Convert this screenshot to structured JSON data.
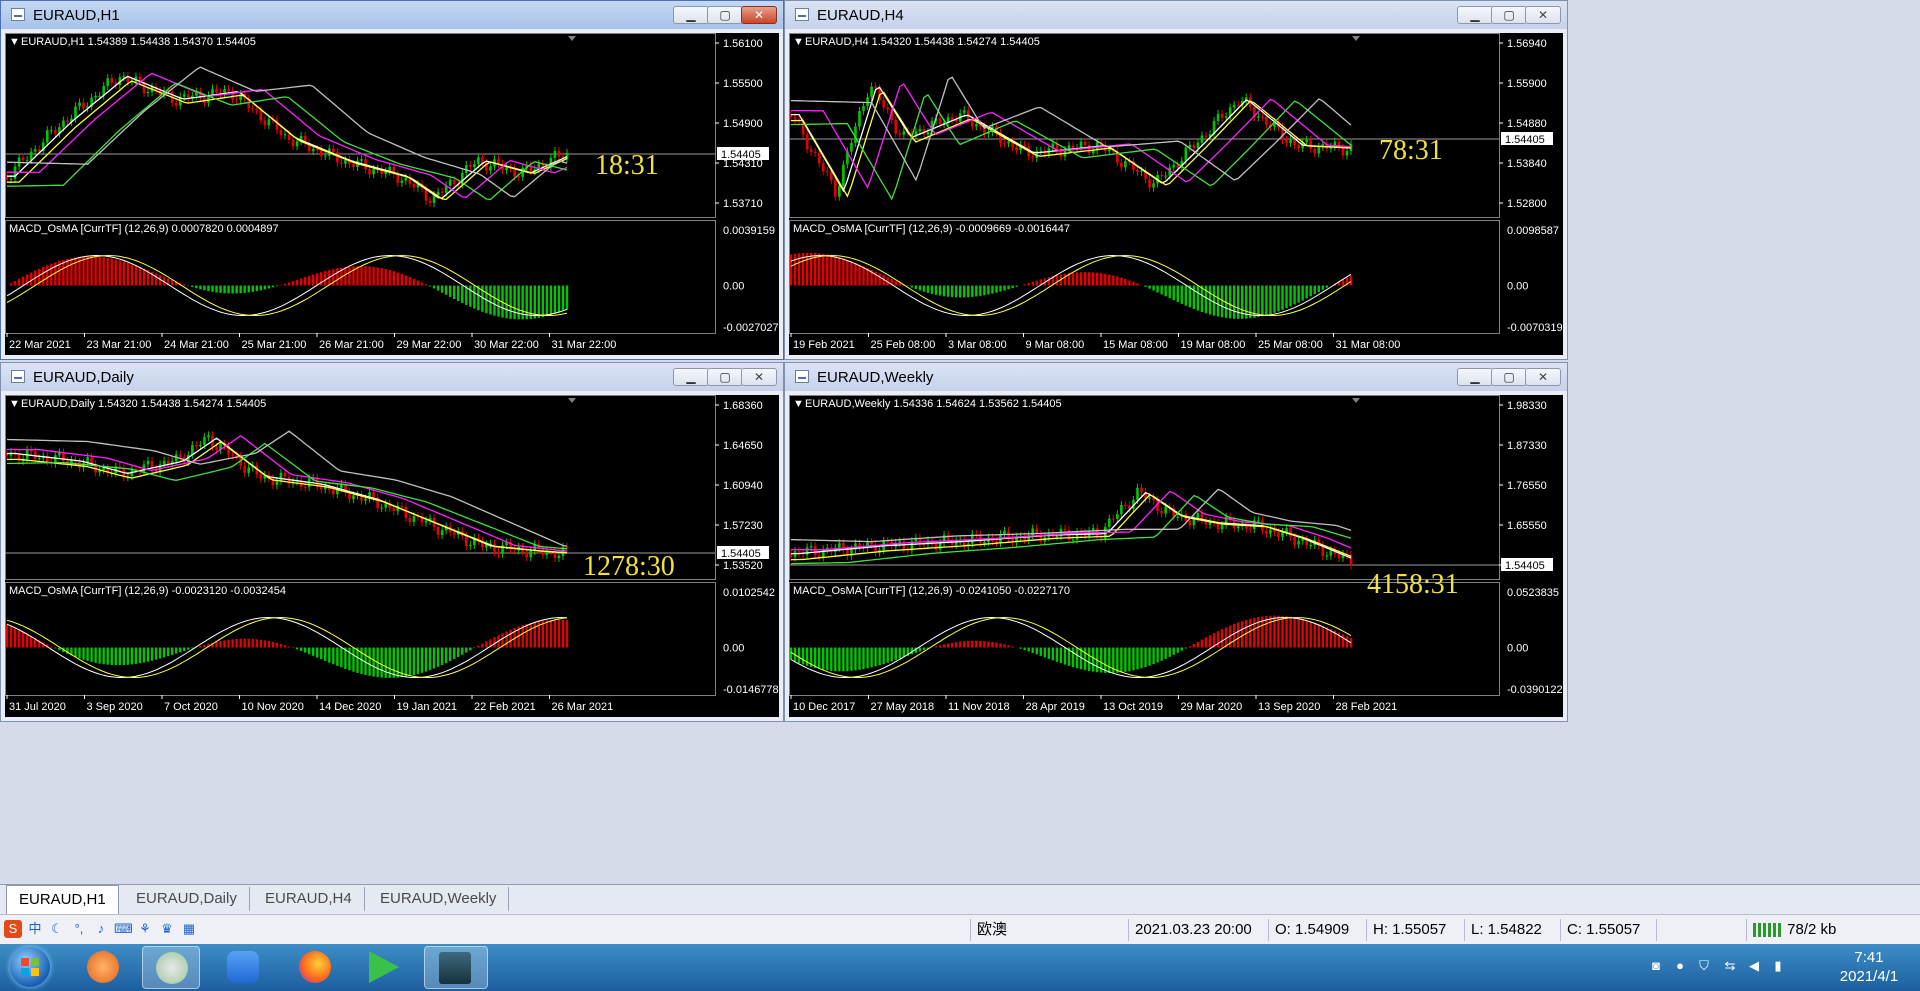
{
  "windows": [
    {
      "id": "h1",
      "title": "EURAUD,H1",
      "active": true,
      "header": "EURAUD,H1  1.54389 1.54438 1.54370 1.54405",
      "price_scale": [
        "1.56100",
        "1.55500",
        "1.54900",
        "1.54310",
        "1.53710"
      ],
      "current_price": "1.54405",
      "countdown": "18:31",
      "indicator_header": "MACD_OsMA [CurrTF] (12,26,9) 0.0007820 0.0004897",
      "indicator_scale": [
        "0.0039159",
        "0.00",
        "-0.0027027"
      ],
      "time_labels": [
        "22 Mar 2021",
        "23 Mar 21:00",
        "24 Mar 21:00",
        "25 Mar 21:00",
        "26 Mar 21:00",
        "29 Mar 22:00",
        "30 Mar 22:00",
        "31 Mar 22:00"
      ]
    },
    {
      "id": "h4",
      "title": "EURAUD,H4",
      "active": false,
      "header": "EURAUD,H4  1.54320 1.54438 1.54274 1.54405",
      "price_scale": [
        "1.56940",
        "1.55900",
        "1.54880",
        "1.53840",
        "1.52800"
      ],
      "current_price": "1.54405",
      "countdown": "78:31",
      "indicator_header": "MACD_OsMA [CurrTF] (12,26,9) -0.0009669 -0.0016447",
      "indicator_scale": [
        "0.0098587",
        "0.00",
        "-0.0070319"
      ],
      "time_labels": [
        "19 Feb 2021",
        "25 Feb 08:00",
        "3 Mar 08:00",
        "9 Mar 08:00",
        "15 Mar 08:00",
        "19 Mar 08:00",
        "25 Mar 08:00",
        "31 Mar 08:00"
      ]
    },
    {
      "id": "daily",
      "title": "EURAUD,Daily",
      "active": false,
      "header": "EURAUD,Daily  1.54320 1.54438 1.54274 1.54405",
      "price_scale": [
        "1.68360",
        "1.64650",
        "1.60940",
        "1.57230",
        "1.53520"
      ],
      "current_price": "1.54405",
      "countdown": "1278:30",
      "indicator_header": "MACD_OsMA [CurrTF] (12,26,9) -0.0023120 -0.0032454",
      "indicator_scale": [
        "0.0102542",
        "0.00",
        "-0.0146778"
      ],
      "time_labels": [
        "31 Jul 2020",
        "3 Sep 2020",
        "7 Oct 2020",
        "10 Nov 2020",
        "14 Dec 2020",
        "19 Jan 2021",
        "22 Feb 2021",
        "26 Mar 2021"
      ]
    },
    {
      "id": "weekly",
      "title": "EURAUD,Weekly",
      "active": false,
      "header": "EURAUD,Weekly  1.54336 1.54624 1.53562 1.54405",
      "price_scale": [
        "1.98330",
        "1.87330",
        "1.76550",
        "1.65550",
        "1.54405"
      ],
      "current_price": "1.54405",
      "countdown": "4158:31",
      "indicator_header": "MACD_OsMA [CurrTF] (12,26,9) -0.0241050 -0.0227170",
      "indicator_scale": [
        "0.0523835",
        "0.00",
        "-0.0390122"
      ],
      "time_labels": [
        "10 Dec 2017",
        "27 May 2018",
        "11 Nov 2018",
        "28 Apr 2019",
        "13 Oct 2019",
        "29 Mar 2020",
        "13 Sep 2020",
        "28 Feb 2021"
      ]
    }
  ],
  "tabs": [
    "EURAUD,H1",
    "EURAUD,Daily",
    "EURAUD,H4",
    "EURAUD,Weekly"
  ],
  "status": {
    "profile": "欧澳",
    "datetime": "2021.03.23 20:00",
    "open": "O: 1.54909",
    "high": "H: 1.55057",
    "low": "L: 1.54822",
    "close": "C: 1.55057",
    "traffic": "78/2 kb"
  },
  "ime": {
    "lang": "中"
  },
  "clock": {
    "time": "7:41",
    "date": "2021/4/1"
  },
  "colors": {
    "bull": "#00c800",
    "bear": "#e60000",
    "ma_fast": "#ffffff",
    "ma_mid": "#ffff40",
    "ma_magenta": "#ff20ff",
    "ma_green": "#40e040",
    "ma_grey": "#c0c0c0",
    "countdown": "#f0e040"
  }
}
